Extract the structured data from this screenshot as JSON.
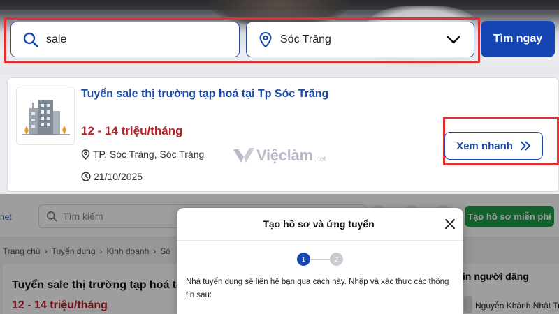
{
  "search": {
    "keyword_value": "sale",
    "location_value": "Sóc Trăng",
    "button_label": "Tìm ngay"
  },
  "job": {
    "title": "Tuyển sale thị trường tạp hoá tại Tp Sóc Trăng",
    "salary": "12 - 14 triệu/tháng",
    "location": "TP. Sóc Trăng, Sóc Trăng",
    "date": "21/10/2025",
    "quick_view_label": "Xem nhanh"
  },
  "watermark": {
    "brand": "Việclàm",
    "suffix": ".net"
  },
  "background_page": {
    "logo_text": "net",
    "search_placeholder": "Tìm kiếm",
    "create_profile_label": "Tạo hồ sơ miễn phí",
    "breadcrumbs": [
      "Trang chủ",
      "Tuyển dụng",
      "Kinh doanh",
      "Só"
    ],
    "job_title": "Tuyển sale thị trường tạp hoá tạ",
    "job_salary": "12 - 14 triệu/tháng",
    "side_title": "in người đăng",
    "poster_name": "Nguyễn Khánh Nhật Trư"
  },
  "modal": {
    "title": "Tạo hồ sơ và ứng tuyển",
    "steps": [
      "1",
      "2"
    ],
    "active_step": 1,
    "description": "Nhà tuyển dụng sẽ liên hệ bạn qua cách này. Nhập và xác thực các thông tin sau:"
  },
  "colors": {
    "primary": "#1646b3",
    "salary_red": "#b4232a",
    "highlight_red": "#e0302f",
    "green": "#1f9d4b"
  }
}
